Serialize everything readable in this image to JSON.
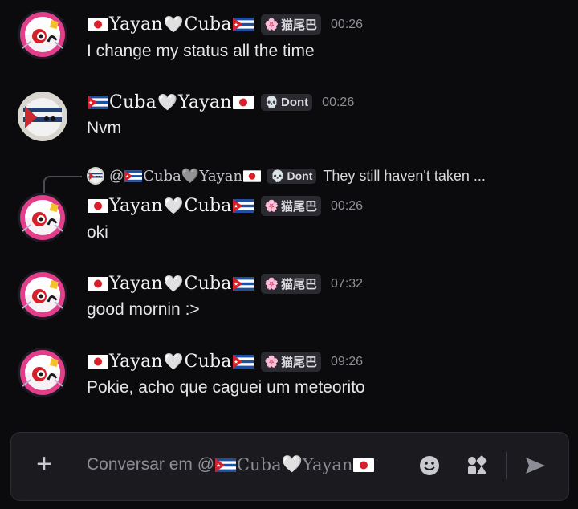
{
  "messages": [
    {
      "user_prefix": "🇯🇵",
      "user": "Yayan",
      "heart": "🤍",
      "user2": "Cuba",
      "user_suffix": "🇨🇺",
      "tag_icon": "🌸",
      "tag": "猫尾巴",
      "time": "00:26",
      "text": "I change my status all the time"
    },
    {
      "user_prefix": "🇨🇺",
      "user": "Cuba",
      "heart": "🤍",
      "user2": "Yayan",
      "user_suffix": "🇯🇵",
      "tag_icon": "💀",
      "tag": "Dont",
      "time": "00:26",
      "text": "Nvm"
    },
    {
      "user_prefix": "🇯🇵",
      "user": "Yayan",
      "heart": "🤍",
      "user2": "Cuba",
      "user_suffix": "🇨🇺",
      "tag_icon": "🌸",
      "tag": "猫尾巴",
      "time": "00:26",
      "text": "oki"
    },
    {
      "user_prefix": "🇯🇵",
      "user": "Yayan",
      "heart": "🤍",
      "user2": "Cuba",
      "user_suffix": "🇨🇺",
      "tag_icon": "🌸",
      "tag": "猫尾巴",
      "time": "07:32",
      "text": "good mornin :>"
    },
    {
      "user_prefix": "🇯🇵",
      "user": "Yayan",
      "heart": "🤍",
      "user2": "Cuba",
      "user_suffix": "🇨🇺",
      "tag_icon": "🌸",
      "tag": "猫尾巴",
      "time": "09:26",
      "text": "Pokie, acho que caguei um meteorito"
    }
  ],
  "reply": {
    "mention": "@",
    "user": "Cuba",
    "heart": "🩶",
    "user2": "Yayan",
    "tag_icon": "💀",
    "tag": "Dont",
    "preview": "They still haven't taken ..."
  },
  "composer": {
    "placeholder_prefix": "Conversar em @",
    "user": "Cuba",
    "heart": "🤍",
    "user2": "Yayan"
  },
  "icons": {
    "add": "plus-icon",
    "emoji": "emoji-icon",
    "apps": "apps-icon",
    "send": "send-icon"
  },
  "colors": {
    "background": "#0b0b0d",
    "composer": "#1b1b1f",
    "tag_bg": "#2a2a30",
    "time": "#8e8f96"
  }
}
